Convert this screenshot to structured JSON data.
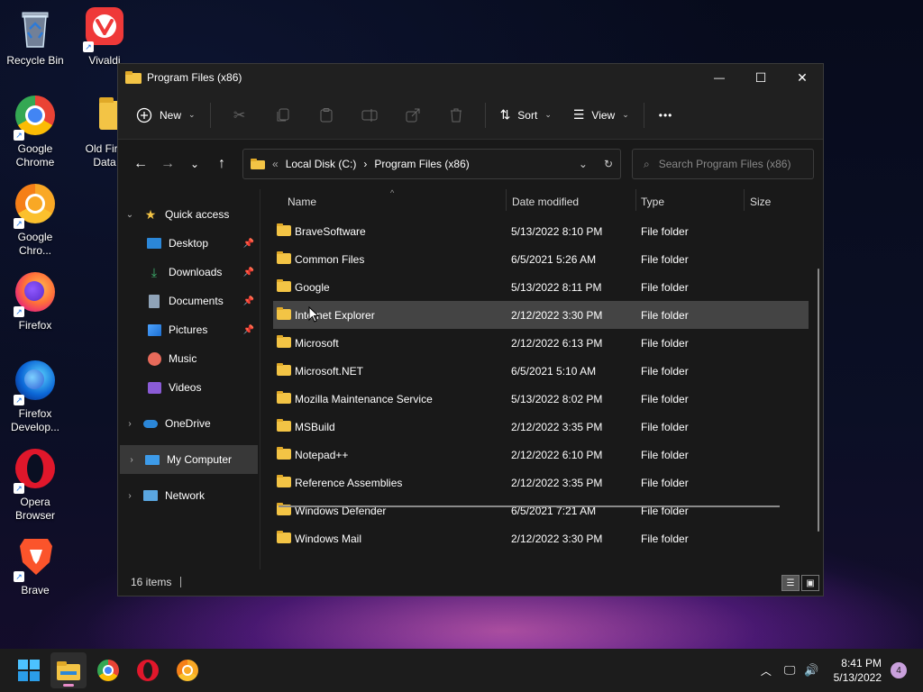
{
  "desktop": {
    "icons": [
      {
        "label": "Recycle Bin"
      },
      {
        "label": "Vivaldi"
      },
      {
        "label": "Google Chrome"
      },
      {
        "label": "Old Fire Data"
      },
      {
        "label": "Google Chro..."
      },
      {
        "label": "Firefox"
      },
      {
        "label": "Firefox Develop..."
      },
      {
        "label": "Opera Browser"
      },
      {
        "label": "Brave"
      }
    ]
  },
  "window": {
    "title": "Program Files (x86)",
    "controls": {
      "minimize": "—",
      "maximize": "☐",
      "close": "✕"
    }
  },
  "toolbar": {
    "new_label": "New",
    "sort_label": "Sort",
    "view_label": "View",
    "more_label": "•••"
  },
  "address": {
    "overflow": "«",
    "crumbs": [
      "Local Disk (C:)",
      "Program Files (x86)"
    ],
    "separator": "›"
  },
  "search": {
    "placeholder": "Search Program Files (x86)"
  },
  "nav_pane": {
    "quick_access": "Quick access",
    "items": [
      {
        "label": "Desktop",
        "pinned": true
      },
      {
        "label": "Downloads",
        "pinned": true
      },
      {
        "label": "Documents",
        "pinned": true
      },
      {
        "label": "Pictures",
        "pinned": true
      },
      {
        "label": "Music",
        "pinned": false
      },
      {
        "label": "Videos",
        "pinned": false
      }
    ],
    "onedrive": "OneDrive",
    "my_computer": "My Computer",
    "network": "Network"
  },
  "columns": {
    "name": "Name",
    "date": "Date modified",
    "type": "Type",
    "size": "Size"
  },
  "files": [
    {
      "name": "BraveSoftware",
      "date": "5/13/2022 8:10 PM",
      "type": "File folder"
    },
    {
      "name": "Common Files",
      "date": "6/5/2021 5:26 AM",
      "type": "File folder"
    },
    {
      "name": "Google",
      "date": "5/13/2022 8:11 PM",
      "type": "File folder"
    },
    {
      "name": "Internet Explorer",
      "date": "2/12/2022 3:30 PM",
      "type": "File folder"
    },
    {
      "name": "Microsoft",
      "date": "2/12/2022 6:13 PM",
      "type": "File folder"
    },
    {
      "name": "Microsoft.NET",
      "date": "6/5/2021 5:10 AM",
      "type": "File folder"
    },
    {
      "name": "Mozilla Maintenance Service",
      "date": "5/13/2022 8:02 PM",
      "type": "File folder"
    },
    {
      "name": "MSBuild",
      "date": "2/12/2022 3:35 PM",
      "type": "File folder"
    },
    {
      "name": "Notepad++",
      "date": "2/12/2022 6:10 PM",
      "type": "File folder"
    },
    {
      "name": "Reference Assemblies",
      "date": "2/12/2022 3:35 PM",
      "type": "File folder"
    },
    {
      "name": "Windows Defender",
      "date": "6/5/2021 7:21 AM",
      "type": "File folder"
    },
    {
      "name": "Windows Mail",
      "date": "2/12/2022 3:30 PM",
      "type": "File folder"
    }
  ],
  "hovered_row": 3,
  "status": {
    "count": "16 items"
  },
  "taskbar": {
    "time": "8:41 PM",
    "date": "5/13/2022",
    "notification_count": "4"
  },
  "colors": {
    "accent": "#e88cc8",
    "folder": "#f3c445",
    "window_bg": "#191919"
  }
}
